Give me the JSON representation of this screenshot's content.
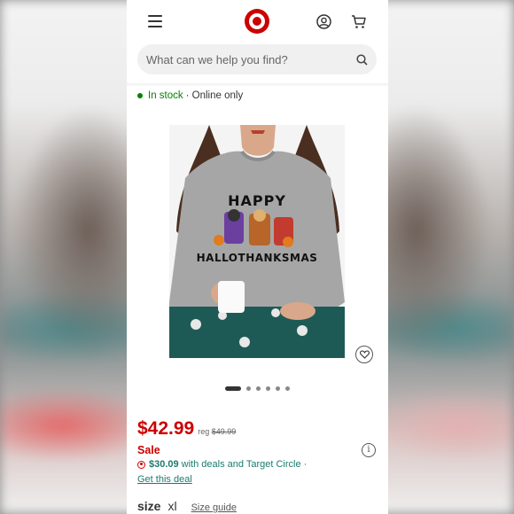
{
  "header": {
    "search_placeholder": "What can we help you find?"
  },
  "availability": {
    "status": "In stock",
    "channel": "· Online only"
  },
  "product_image": {
    "print_line1": "HAPPY",
    "print_line2": "HALLOTHANKSMAS"
  },
  "carousel": {
    "count": 6,
    "active_index": 0
  },
  "pricing": {
    "price": "$42.99",
    "reg_label": "reg",
    "reg_price": "$49.99",
    "sale_label": "Sale",
    "circle_amount": "$30.09",
    "circle_text": "with deals and Target Circle ·",
    "deal_link": "Get this deal"
  },
  "size": {
    "label": "size",
    "value": "xl",
    "guide_link": "Size guide"
  },
  "colors": {
    "brand_red": "#cc0000",
    "stock_green": "#008300",
    "link_teal": "#1a7b6f"
  }
}
